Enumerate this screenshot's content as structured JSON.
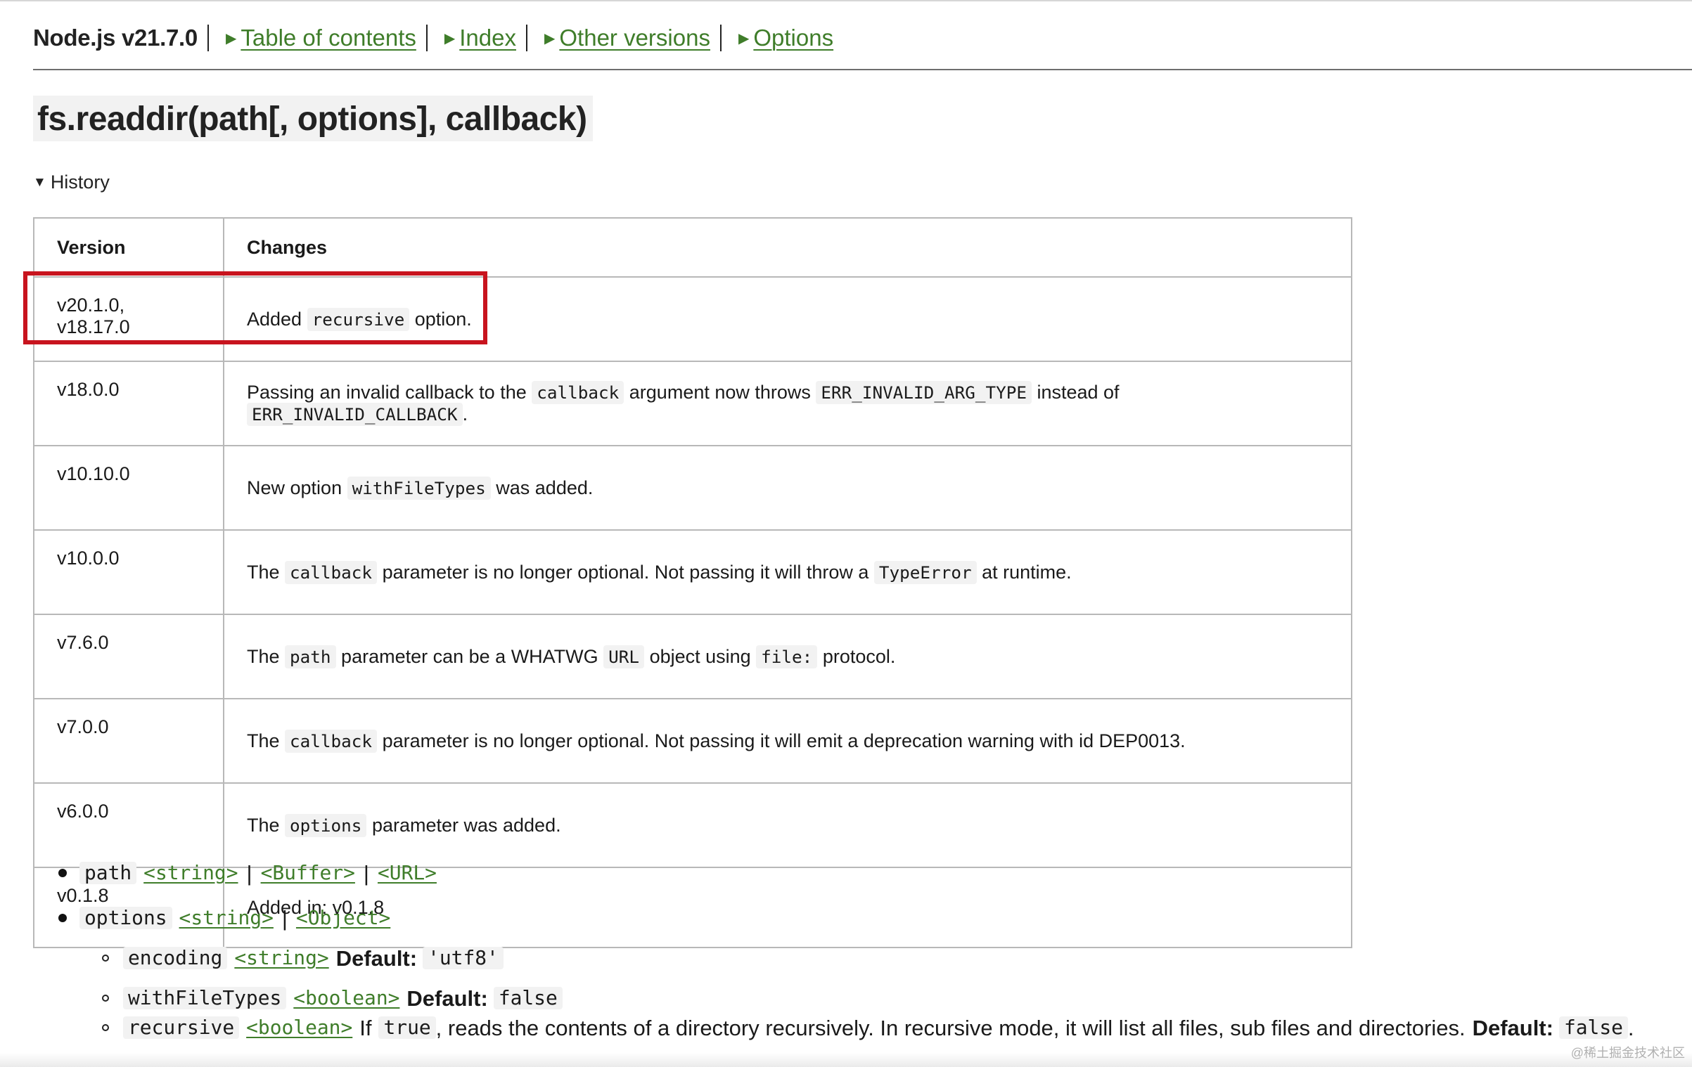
{
  "nav": {
    "title": "Node.js v21.7.0",
    "links": [
      {
        "label": "Table of contents"
      },
      {
        "label": "Index"
      },
      {
        "label": "Other versions"
      },
      {
        "label": "Options"
      }
    ]
  },
  "heading": "fs.readdir(path[, options], callback)",
  "history": {
    "toggle_label": "History",
    "columns": [
      "Version",
      "Changes"
    ],
    "rows": [
      {
        "version": "v20.1.0, v18.17.0",
        "parts": [
          "Added ",
          "recursive",
          " option."
        ]
      },
      {
        "version": "v18.0.0",
        "parts": [
          "Passing an invalid callback to the ",
          "callback",
          " argument now throws ",
          "ERR_INVALID_ARG_TYPE",
          " instead of ",
          "ERR_INVALID_CALLBACK",
          "."
        ]
      },
      {
        "version": "v10.10.0",
        "parts": [
          "New option ",
          "withFileTypes",
          " was added."
        ]
      },
      {
        "version": "v10.0.0",
        "parts": [
          "The ",
          "callback",
          " parameter is no longer optional. Not passing it will throw a ",
          "TypeError",
          " at runtime."
        ]
      },
      {
        "version": "v7.6.0",
        "parts": [
          "The ",
          "path",
          " parameter can be a WHATWG ",
          "URL",
          " object using ",
          "file:",
          " protocol."
        ]
      },
      {
        "version": "v7.0.0",
        "parts": [
          "The ",
          "callback",
          " parameter is no longer optional. Not passing it will emit a deprecation warning with id DEP0013."
        ]
      },
      {
        "version": "v6.0.0",
        "parts": [
          "The ",
          "options",
          " parameter was added."
        ]
      },
      {
        "version": "v0.1.8",
        "parts": [
          "Added in: v0.1.8"
        ]
      }
    ]
  },
  "params": {
    "path": {
      "name": "path",
      "types": [
        "<string>",
        "<Buffer>",
        "<URL>"
      ]
    },
    "options": {
      "name": "options",
      "types": [
        "<string>",
        "<Object>"
      ],
      "sub": {
        "encoding": {
          "name": "encoding",
          "type": "<string>",
          "default_label": "Default:",
          "default_value": "'utf8'"
        },
        "withFileTypes": {
          "name": "withFileTypes",
          "type": "<boolean>",
          "default_label": "Default:",
          "default_value": "false"
        },
        "recursive": {
          "name": "recursive",
          "type": "<boolean>",
          "if_text": "If",
          "true_value": "true",
          "desc": ", reads the contents of a directory recursively. In recursive mode, it will list all files, sub files and directories.",
          "default_label": "Default:",
          "default_value": "false",
          "end": "."
        }
      }
    }
  },
  "watermark": "@稀土掘金技术社区",
  "colors": {
    "link": "#3f7d2a",
    "highlight": "#c8141e",
    "code_bg": "#f2f2f2"
  }
}
